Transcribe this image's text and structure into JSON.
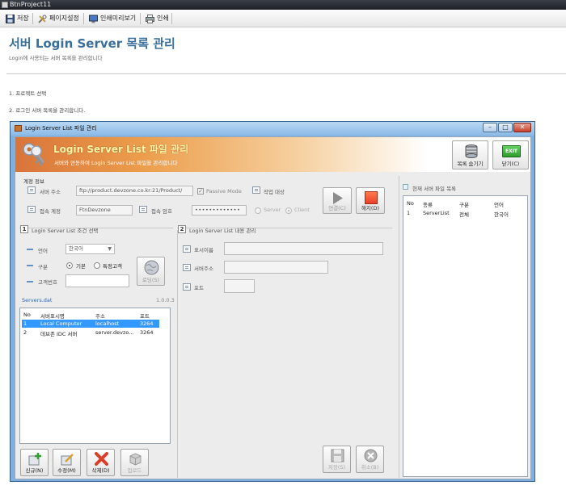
{
  "app": {
    "title": "BtnProject11"
  },
  "toolbar": {
    "save_label": "저장",
    "page_setup_label": "페이지설정",
    "print_preview_label": "인쇄미리보기",
    "print_label": "인쇄"
  },
  "page": {
    "title": "서버 Login Server 목록 관리",
    "subtitle": "Login에 사용되는 서버 목록을 관리합니다",
    "step1": "1. 프로젝트 선택",
    "step2": "2. 로그인 서버 목록을 관리합니다."
  },
  "window": {
    "title": "Login Server List 파일 관리",
    "banner_title": "Login Server List 파일 관리",
    "banner_subtitle": "서버와 연동하여 Login Server List 파일을 관리합니다",
    "list_hide_label": "목록 숨기기",
    "close_label": "닫기(C)",
    "exit_icon_text": "EXIT"
  },
  "account": {
    "section_label": "계정 정보",
    "server_address_label": "서버 주소",
    "server_address_value": "ftp://product.devzone.co.kr:21/Product/",
    "passive_mode_label": "Passive Mode",
    "target_label": "작업 대상",
    "account_label": "접속 계정",
    "account_value": "FtnDevzone",
    "password_label": "접속 암호",
    "password_value": "•••••••••••••",
    "server_radio_label": "Server",
    "client_radio_label": "Client",
    "connect_label": "연결(C)",
    "disconnect_label": "해지(D)"
  },
  "condition": {
    "section_number": "1",
    "section_title": "Login Server List 조건 선택",
    "language_label": "언어",
    "language_value": "한국어",
    "type_label": "구분",
    "type_basic": "기본",
    "type_special": "특정고객",
    "customer_no_label": "고객번호",
    "customer_no_value": "",
    "load_label": "로딩(S)"
  },
  "servers": {
    "file_label": "Servers.dat",
    "version": "1.0.0.3",
    "columns": [
      "No",
      "서버표시명",
      "주소",
      "포트"
    ],
    "rows": [
      {
        "no": "1",
        "name": "Local Computer",
        "address": "localhost",
        "port": "3264"
      },
      {
        "no": "2",
        "name": "데브존 IDC 서버",
        "address": "server.devzo...",
        "port": "3264"
      }
    ]
  },
  "bottom": {
    "new_label": "신규(N)",
    "edit_label": "수정(M)",
    "delete_label": "삭제(D)",
    "upload_label": "업로드"
  },
  "content": {
    "section_number": "2",
    "section_title": "Login Server List 내용 관리",
    "display_name_label": "표시이름",
    "server_address_label": "서버주소",
    "port_label": "포트",
    "save_label": "저장(S)",
    "cancel_label": "취소(B)"
  },
  "current": {
    "title": "현재 서버 파일 목록",
    "columns": [
      "No",
      "종류",
      "구분",
      "언어"
    ],
    "rows": [
      {
        "no": "1",
        "kind": "ServerList",
        "type": "전체",
        "lang": "한국어"
      }
    ]
  },
  "colors": {
    "title_blue": "#3b6f9b",
    "selection": "#3399ff",
    "disconnect_red": "#e8402a",
    "delete_red": "#d9402a",
    "exit_green": "#2f9b2f"
  }
}
